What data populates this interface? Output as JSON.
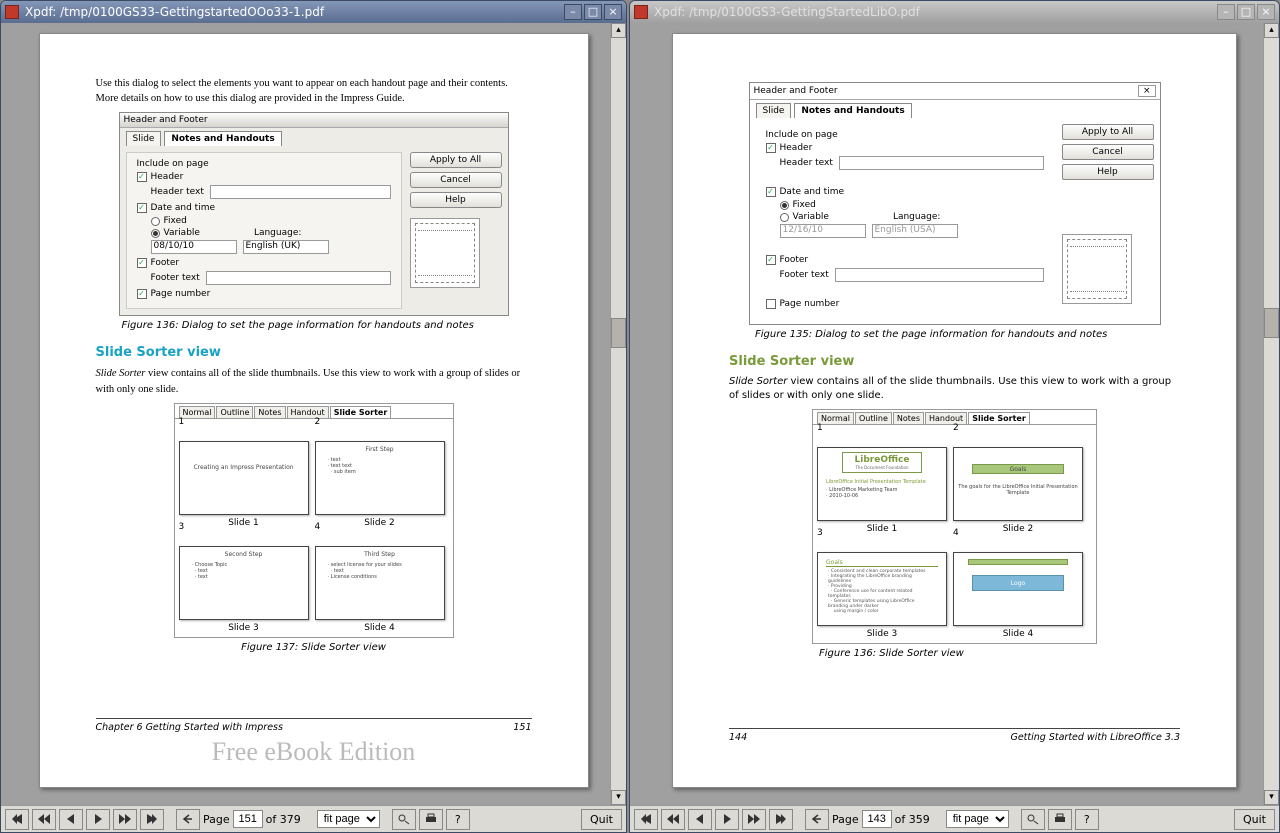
{
  "left": {
    "title": "Xpdf: /tmp/0100GS33-GettingstartedOOo33-1.pdf",
    "intro": "Use this dialog to select the elements you want to appear on each handout page and their contents. More details on how to use this dialog are provided in the Impress Guide.",
    "dlg": {
      "title": "Header and Footer",
      "tab_slide": "Slide",
      "tab_notes": "Notes and Handouts",
      "include": "Include on page",
      "chk_header": "Header",
      "lbl_header": "Header text",
      "chk_dt": "Date and time",
      "r_fixed": "Fixed",
      "r_var": "Variable",
      "date": "08/10/10",
      "lang_lbl": "Language:",
      "lang": "English (UK)",
      "chk_footer": "Footer",
      "lbl_footer": "Footer text",
      "chk_page": "Page number",
      "b_apply": "Apply to All",
      "b_cancel": "Cancel",
      "b_help": "Help"
    },
    "cap1": "Figure 136: Dialog to set the page information for handouts and notes",
    "h2": "Slide Sorter view",
    "p2a": "Slide Sorter",
    "p2b": " view contains all of the slide thumbnails. Use this view to work with a group of slides or with only one slide.",
    "sorter": {
      "tabs": [
        "Normal",
        "Outline",
        "Notes",
        "Handout",
        "Slide Sorter"
      ],
      "s1": "Slide 1",
      "s2": "Slide 2",
      "s3": "Slide 3",
      "s4": "Slide 4",
      "t1": "Creating an Impress Presentation",
      "t2": "First Step",
      "t3": "Second Step",
      "t4": "Third Step"
    },
    "cap2": "Figure 137: Slide Sorter view",
    "chapter": "Chapter 6  Getting Started with Impress",
    "pageno": "151",
    "ebook": "Free eBook Edition",
    "nav": {
      "page_lbl": "Page",
      "page": "151",
      "of": "of 379",
      "zoom": "fit page",
      "quit": "Quit",
      "q": "?"
    }
  },
  "right": {
    "title": "Xpdf: /tmp/0100GS3-GettingStartedLibO.pdf",
    "dlg": {
      "title": "Header and Footer",
      "tab_slide": "Slide",
      "tab_notes": "Notes and Handouts",
      "include": "Include on page",
      "chk_header": "Header",
      "lbl_header": "Header text",
      "chk_dt": "Date and time",
      "r_fixed": "Fixed",
      "r_var": "Variable",
      "date": "12/16/10",
      "lang_lbl": "Language:",
      "lang": "English (USA)",
      "chk_footer": "Footer",
      "lbl_footer": "Footer text",
      "chk_page": "Page number",
      "b_apply": "Apply to All",
      "b_cancel": "Cancel",
      "b_help": "Help"
    },
    "cap1": "Figure 135: Dialog to set the page information for handouts and notes",
    "h2": "Slide Sorter view",
    "p2a": "Slide Sorter",
    "p2b": " view contains all of the slide thumbnails. Use this view to work with a group of slides or with only one slide.",
    "sorter": {
      "tabs": [
        "Normal",
        "Outline",
        "Notes",
        "Handout",
        "Slide Sorter"
      ],
      "s1": "Slide 1",
      "s2": "Slide 2",
      "s3": "Slide 3",
      "s4": "Slide 4",
      "logo": "LibreOffice",
      "logosub": "The Document Foundation",
      "t1": "LibreOffice Initial Presentation Template",
      "t1b": "· LibreOffice Marketing Team",
      "t1c": "· 2010-10-06",
      "t2": "Goals",
      "t2b": "The goals for the LibreOffice Initial Presentation Template",
      "t3": "Goals",
      "t4": "Logo"
    },
    "cap2": "Figure 136: Slide Sorter view",
    "pnum": "144",
    "chapter": "Getting Started with LibreOffice 3.3",
    "nav": {
      "page_lbl": "Page",
      "page": "143",
      "of": "of 359",
      "zoom": "fit page",
      "quit": "Quit",
      "q": "?"
    }
  }
}
